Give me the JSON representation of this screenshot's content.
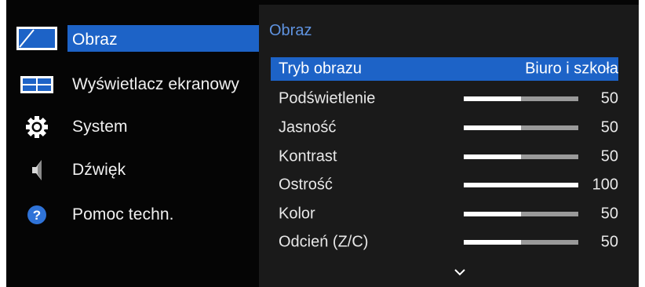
{
  "menu": {
    "items": [
      {
        "label": "Obraz",
        "icon": "picture-icon",
        "selected": true
      },
      {
        "label": "Wyświetlacz ekranowy",
        "icon": "onscreen-display-icon",
        "selected": false
      },
      {
        "label": "System",
        "icon": "gear-icon",
        "selected": false
      },
      {
        "label": "Dźwięk",
        "icon": "speaker-icon",
        "selected": false
      },
      {
        "label": "Pomoc techn.",
        "icon": "question-icon",
        "selected": false
      }
    ]
  },
  "panel": {
    "title": "Obraz",
    "rows": [
      {
        "label": "Tryb obrazu",
        "value": "Biuro i szkoła",
        "selected": true
      },
      {
        "label": "Podświetlenie",
        "value": "50",
        "level": 0.5
      },
      {
        "label": "Jasność",
        "value": "50",
        "level": 0.5
      },
      {
        "label": "Kontrast",
        "value": "50",
        "level": 0.5
      },
      {
        "label": "Ostrość",
        "value": "100",
        "level": 1.0
      },
      {
        "label": "Kolor",
        "value": "50",
        "level": 0.5
      },
      {
        "label": "Odcień (Z/C)",
        "value": "50",
        "level": 0.5
      }
    ],
    "more_icon": "chevron-down-icon"
  },
  "colors": {
    "accent": "#1d63c7",
    "title": "#5f93e0",
    "background": "#050505",
    "panel": "#1a1a1a"
  }
}
